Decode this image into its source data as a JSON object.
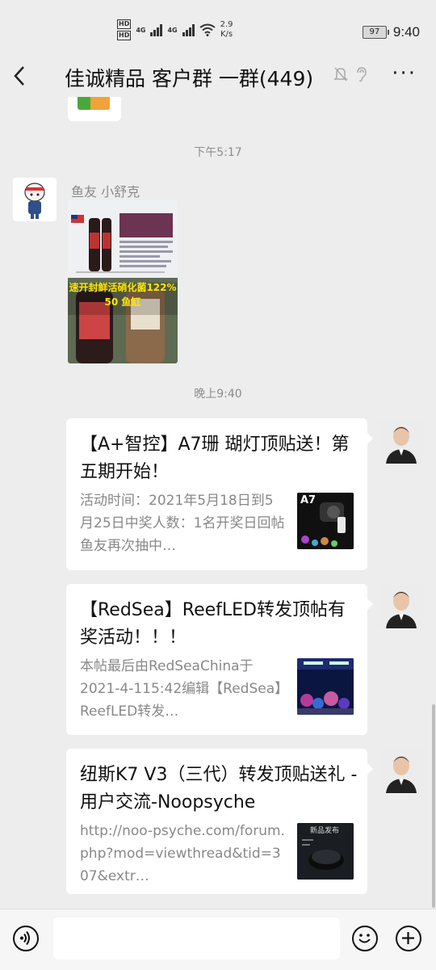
{
  "status_bar": {
    "hd1": "HD",
    "hd2": "HD",
    "net1": "4G",
    "net2": "4G",
    "speed_value": "2.9",
    "speed_unit": "K/s",
    "battery": "97",
    "time": "9:40"
  },
  "header": {
    "back_icon": "chevron-left-icon",
    "title": "佳诚精品 客户群 一群(449)",
    "mute_icon": "bell-off-icon",
    "ear_icon": "ear-icon",
    "more_label": "···"
  },
  "messages": {
    "timestamp_1": "下午5:17",
    "sender_1": "鱼友 小舒克",
    "image_caption": "速开封鲜活硝化菌122%",
    "image_caption_2": "50 鱼缸",
    "timestamp_2": "晚上9:40",
    "cards": [
      {
        "title": "【A+智控】A7珊 瑚灯顶贴送！第五期开始！",
        "desc": "活动时间：2021年5月18日到5月25日中奖人数：1名开奖日回帖鱼友再次抽中…",
        "thumb_label": "A7"
      },
      {
        "title": "【RedSea】ReefLED转发顶帖有奖活动！！！",
        "desc": "本帖最后由RedSeaChina于2021-4-115:42编辑【RedSea】ReefLED转发…"
      },
      {
        "title": "纽斯K7 V3（三代）转发顶贴送礼 - 用户交流-Noopsyche",
        "desc": "http://noo-psyche.com/forum.php?mod=viewthread&tid=307&extr…",
        "thumb_label": "新品发布"
      }
    ]
  },
  "input_bar": {
    "voice_icon": "voice-icon",
    "emoji_icon": "emoji-icon",
    "plus_icon": "plus-icon"
  }
}
